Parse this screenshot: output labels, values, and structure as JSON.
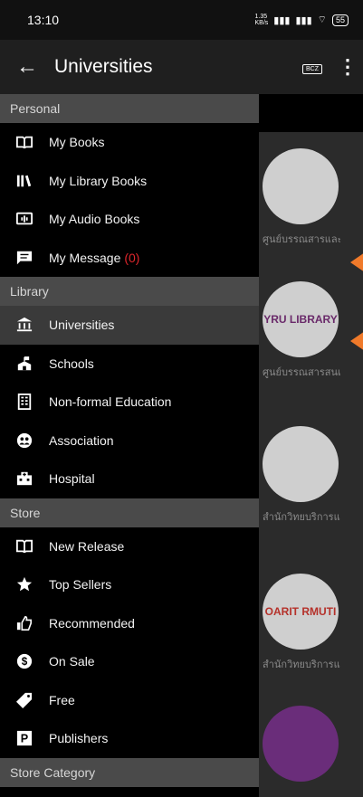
{
  "status_bar": {
    "time": "13:10",
    "data_speed": "1.35\nKB/s",
    "battery": "55"
  },
  "app_bar": {
    "title": "Universities",
    "back_glyph": "←",
    "more_glyph": "⋮",
    "book_label": "BCZ"
  },
  "sections": {
    "personal": "Personal",
    "library": "Library",
    "store": "Store",
    "store_category": "Store Category"
  },
  "items": {
    "my_books": "My Books",
    "my_library_books": "My Library Books",
    "my_audio_books": "My Audio Books",
    "my_message": "My Message",
    "my_message_count": "(0)",
    "universities": "Universities",
    "schools": "Schools",
    "non_formal": "Non-formal Education",
    "association": "Association",
    "hospital": "Hospital",
    "new_release": "New Release",
    "top_sellers": "Top Sellers",
    "recommended": "Recommended",
    "on_sale": "On Sale",
    "free": "Free",
    "publishers": "Publishers"
  },
  "background_list": [
    {
      "caption": "ศูนย์บรรณสารและ",
      "logo": ""
    },
    {
      "caption": "ศูนย์บรรณสารสนเท",
      "logo": "YRU LIBRARY"
    },
    {
      "caption": "สำนักวิทยบริการและ",
      "logo": ""
    },
    {
      "caption": "สำนักวิทยบริการและ",
      "logo": "OARIT RMUTI"
    },
    {
      "caption": "",
      "logo": ""
    }
  ],
  "colors": {
    "accent_arrow": "#f07a2a",
    "badge_red": "#e0262c",
    "section_bg": "#4a4a4a",
    "active_bg": "#3a3a3a"
  },
  "icons": [
    "back-arrow-icon",
    "book-reader-icon",
    "more-vert-icon",
    "open-book-icon",
    "library-books-icon",
    "audio-book-icon",
    "message-icon",
    "bank-icon",
    "school-icon",
    "building-icon",
    "group-icon",
    "hospital-icon",
    "new-release-book-icon",
    "star-icon",
    "thumbs-up-icon",
    "dollar-circle-icon",
    "tag-icon",
    "publisher-p-icon"
  ]
}
